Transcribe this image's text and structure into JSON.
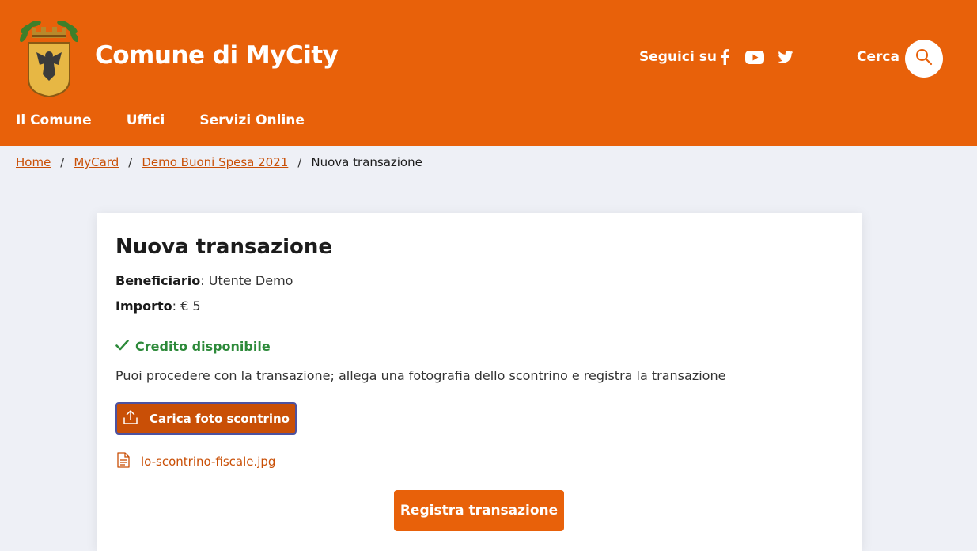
{
  "header": {
    "site_title": "Comune di MyCity",
    "logo_icon": "city-coat-of-arms-icon",
    "social_label": "Seguici su",
    "social": [
      {
        "icon": "facebook-icon"
      },
      {
        "icon": "youtube-icon"
      },
      {
        "icon": "twitter-icon"
      }
    ],
    "search_label": "Cerca",
    "search_icon": "search-icon"
  },
  "nav": {
    "items": [
      {
        "label": "Il Comune"
      },
      {
        "label": "Uffici"
      },
      {
        "label": "Servizi Online"
      }
    ]
  },
  "breadcrumb": {
    "items": [
      {
        "label": "Home"
      },
      {
        "label": "MyCard"
      },
      {
        "label": "Demo Buoni Spesa 2021"
      }
    ],
    "current": "Nuova transazione",
    "separator": "/"
  },
  "card": {
    "title": "Nuova transazione",
    "beneficiary_label": "Beneficiario",
    "beneficiary_value": ": Utente Demo",
    "amount_label": "Importo",
    "amount_value": ": € 5",
    "status_text": "Credito disponibile",
    "description": "Puoi procedere con la transazione; allega una fotografia dello scontrino e registra la transazione",
    "upload_label": "Carica foto scontrino",
    "file_name": "lo-scontrino-fiscale.jpg",
    "submit_label": "Registra transazione"
  },
  "colors": {
    "brand": "#e8610a",
    "brand_dark": "#c94f06",
    "success": "#2d8a3a",
    "background": "#eef0f6"
  }
}
